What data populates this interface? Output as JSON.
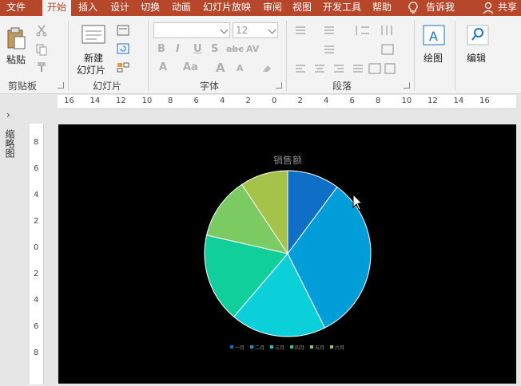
{
  "tabs": [
    {
      "label": "文件",
      "active": false
    },
    {
      "label": "开始",
      "active": true
    },
    {
      "label": "插入",
      "active": false
    },
    {
      "label": "设计",
      "active": false
    },
    {
      "label": "切换",
      "active": false
    },
    {
      "label": "动画",
      "active": false
    },
    {
      "label": "幻灯片放映",
      "active": false
    },
    {
      "label": "审阅",
      "active": false
    },
    {
      "label": "视图",
      "active": false
    },
    {
      "label": "开发工具",
      "active": false
    },
    {
      "label": "帮助",
      "active": false
    }
  ],
  "tell_me": "告诉我",
  "share": "共享",
  "ribbon": {
    "paste_label": "粘贴",
    "clipboard_group": "剪贴板",
    "new_slide_line1": "新建",
    "new_slide_line2": "幻灯片",
    "slides_group": "幻灯片",
    "font_name": "",
    "font_size": "12",
    "font_group": "字体",
    "paragraph_group": "段落",
    "drawing_label": "绘图",
    "editing_label": "编辑",
    "format_letters": [
      "B",
      "I",
      "U",
      "S",
      "abc",
      "AV"
    ],
    "font_letters": [
      "A",
      "Aa",
      "A",
      "A"
    ]
  },
  "ruler": {
    "h_labels": [
      "16",
      "14",
      "12",
      "10",
      "8",
      "6",
      "4",
      "2",
      "0",
      "2",
      "4",
      "6",
      "8",
      "10",
      "12",
      "14",
      "16"
    ],
    "v_labels": [
      "8",
      "6",
      "4",
      "2",
      "0",
      "2",
      "4",
      "6",
      "8"
    ]
  },
  "side_panel_label": "缩略图",
  "colors": {
    "accent": "#b7472a",
    "slide_bg": "#000000"
  },
  "chart_data": {
    "type": "pie",
    "title": "销售额",
    "categories": [
      "一月",
      "二月",
      "三月",
      "四月",
      "五月",
      "六月"
    ],
    "values": [
      8.2,
      26.2,
      15.0,
      14.0,
      9.8,
      7.5
    ],
    "colors": [
      "#0f6fc6",
      "#009dd9",
      "#0bd0d9",
      "#10cf9b",
      "#7cca62",
      "#a5c249"
    ],
    "legend_position": "bottom"
  }
}
